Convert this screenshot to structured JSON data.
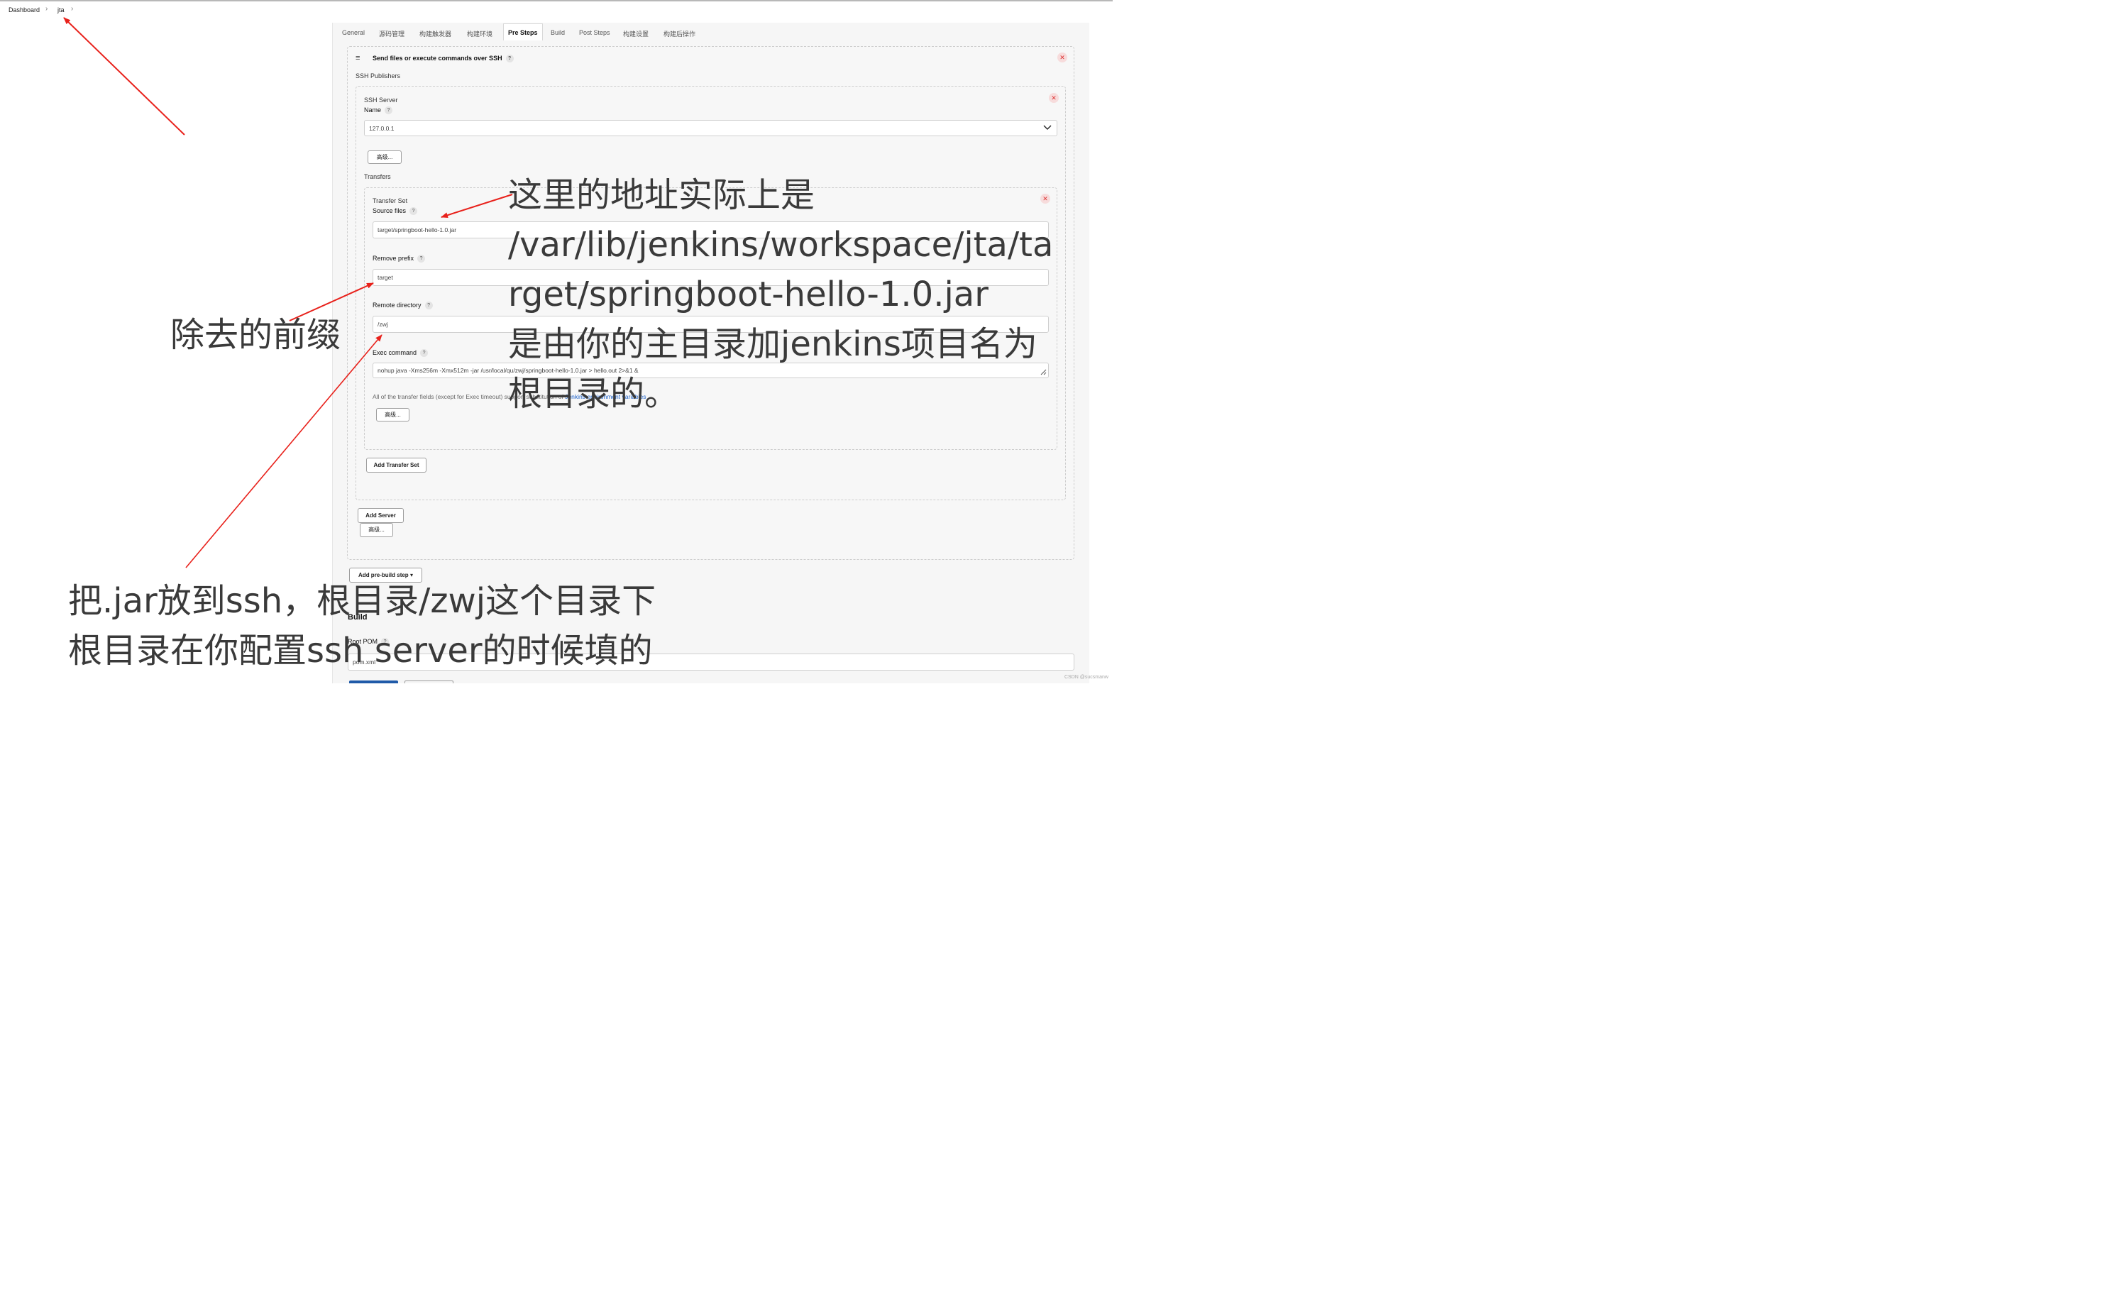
{
  "breadcrumb": {
    "items": [
      "Dashboard",
      "jta"
    ]
  },
  "tabs": [
    "General",
    "源码管理",
    "构建触发器",
    "构建环境",
    "Pre Steps",
    "Build",
    "Post Steps",
    "构建设置",
    "构建后操作"
  ],
  "active_tab": "Pre Steps",
  "step": {
    "title": "Send files or execute commands over SSH",
    "publishers_label": "SSH Publishers"
  },
  "server": {
    "section_label": "SSH Server",
    "name_label": "Name",
    "name_value": "127.0.0.1",
    "advanced_label": "高级..."
  },
  "transfers": {
    "label": "Transfers",
    "set_label": "Transfer Set",
    "source_files_label": "Source files",
    "source_files_value": "target/springboot-hello-1.0.jar",
    "remove_prefix_label": "Remove prefix",
    "remove_prefix_value": "target",
    "remote_directory_label": "Remote directory",
    "remote_directory_value": "/zwj",
    "exec_command_label": "Exec command",
    "exec_command_value": "nohup java -Xms256m -Xmx512m -jar /usr/local/qu/zwj/springboot-hello-1.0.jar  > hello.out  2>&1 &",
    "note_prefix": "All of the transfer fields (except for Exec timeout) support substitution of ",
    "note_link": "Jenkins environment variables",
    "advanced_label": "高级...",
    "add_transfer_set": "Add Transfer Set"
  },
  "add_server": "Add Server",
  "advanced_bottom": "高级...",
  "add_pre_build_step": "Add pre-build step",
  "build_section": {
    "heading": "Build",
    "root_pom_label": "Root POM",
    "root_pom_value": "pom.xml"
  },
  "annotations": {
    "right_lines": [
      "这里的地址实际上是",
      "/var/lib/jenkins/workspace/jta/ta",
      "rget/springboot-hello-1.0.jar",
      "是由你的主目录加jenkins项目名为",
      "根目录的。"
    ],
    "left_label": "除去的前缀",
    "bottom_lines": [
      "把.jar放到ssh，根目录/zwj这个目录下",
      "根目录在你配置ssh server的时候填的"
    ]
  },
  "watermark": "CSDN @sucsmanw",
  "colors": {
    "annotation_arrow": "#e8211b",
    "link": "#1a5fc8"
  }
}
